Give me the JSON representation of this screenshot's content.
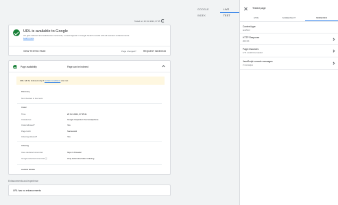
{
  "top_tabs": [
    {
      "label": "GOOGLE INDEX",
      "active": false
    },
    {
      "label": "LIVE TEST",
      "active": true
    }
  ],
  "tested_on": "Tested on: 20 Oct 2024, 07:35",
  "status_card": {
    "title": "URL is available to Google",
    "description": "If it gets indexed and selected as canonical, it could appear in Google Search results with all relevant enhancements.",
    "learn_more_link": "Learn more",
    "view_tested_page": "VIEW TESTED PAGE",
    "page_changed": "Page changed?",
    "request_indexing": "REQUEST INDEXING"
  },
  "availability": {
    "label": "Page availability",
    "value": "Page can be indexed",
    "warning_prefix": "URL will be indexed only if",
    "warning_link": "certain conditions",
    "warning_suffix": "are met",
    "discovery": {
      "heading": "Discovery",
      "text": "Not checked in live tests"
    },
    "crawl": {
      "heading": "Crawl",
      "rows": [
        {
          "key": "Time",
          "value": "20 Oct 2024, 07:35:41"
        },
        {
          "key": "Crawled as",
          "value": "Google Inspection Tool smartphone"
        },
        {
          "key": "Crawl allowed?",
          "value": "Yes"
        },
        {
          "key": "Page fetch",
          "value": "Successful"
        },
        {
          "key": "Indexing allowed?",
          "value": "Yes"
        }
      ]
    },
    "indexing": {
      "heading": "Indexing",
      "rows": [
        {
          "key": "User-declared canonical",
          "value": "https://                    /threads/"
        },
        {
          "key": "Google-selected canonical ⓘ",
          "value": "Only determined after indexing"
        }
      ]
    },
    "learn_more": "LEARN MORE"
  },
  "enhancements": {
    "heading": "Enhancements and experience",
    "text": "URL has no enhancements"
  },
  "panel": {
    "title": "Tested page",
    "tabs": [
      {
        "label": "HTML",
        "active": false
      },
      {
        "label": "SCREENSHOT",
        "active": false
      },
      {
        "label": "MORE INFO",
        "active": true
      }
    ],
    "items": [
      {
        "title": "Content type",
        "sub": "text/html",
        "chevron": false
      },
      {
        "title": "HTTP Response",
        "sub": "200 OK",
        "chevron": true
      },
      {
        "title": "Page resources",
        "sub": "1/71 couldn't be loaded",
        "chevron": true
      },
      {
        "title": "JavaScript console messages",
        "sub": "2 messages",
        "chevron": true
      }
    ]
  }
}
